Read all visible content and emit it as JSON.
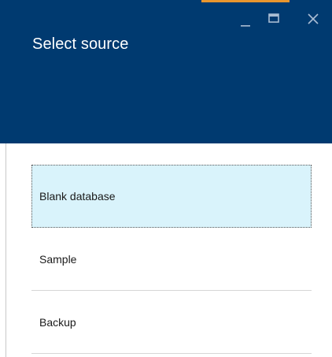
{
  "header": {
    "title": "Select source",
    "background_color": "#003a70",
    "accent_color": "#e8962f"
  },
  "window_controls": {
    "minimize_icon": "minimize-icon",
    "maximize_icon": "maximize-icon",
    "close_icon": "close-icon"
  },
  "sources": {
    "items": [
      {
        "label": "Blank database",
        "selected": true
      },
      {
        "label": "Sample",
        "selected": false
      },
      {
        "label": "Backup",
        "selected": false
      }
    ],
    "selected_background": "#d9f3fb"
  }
}
